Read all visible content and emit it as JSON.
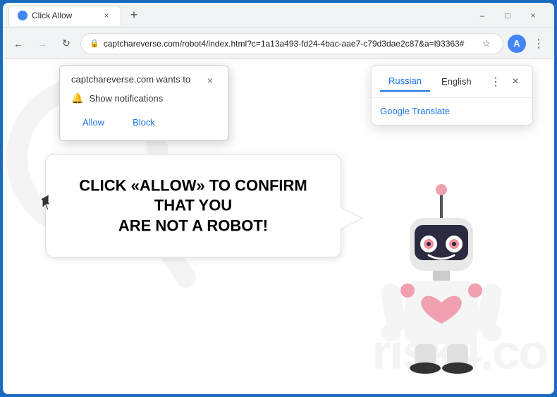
{
  "browser": {
    "title_bar": {
      "tab_title": "Click Allow",
      "close_label": "×",
      "minimize_label": "–",
      "maximize_label": "□",
      "new_tab_label": "+"
    },
    "nav": {
      "back_label": "←",
      "forward_label": "→",
      "refresh_label": "↻",
      "url": "captchareverse.com/robot4/index.html?c=1a13a493-fd24-4bac-aae7-c79d3dae2c87&a=l93363#",
      "bookmark_icon": "☆",
      "account_icon": "A",
      "menu_icon": "⋮"
    }
  },
  "notification_popup": {
    "title": "captchareverse.com wants to",
    "close_label": "×",
    "notification_text": "Show notifications",
    "allow_label": "Allow",
    "block_label": "Block"
  },
  "translation_popup": {
    "lang_russian": "Russian",
    "lang_english": "English",
    "menu_label": "⋮",
    "close_label": "×",
    "google_translate": "Google Translate"
  },
  "main_content": {
    "bubble_text_line1": "CLICK «ALLOW» TO CONFIRM THAT YOU",
    "bubble_text_line2": "ARE NOT A ROBOT!"
  },
  "watermark": {
    "text": "risk4.co"
  }
}
